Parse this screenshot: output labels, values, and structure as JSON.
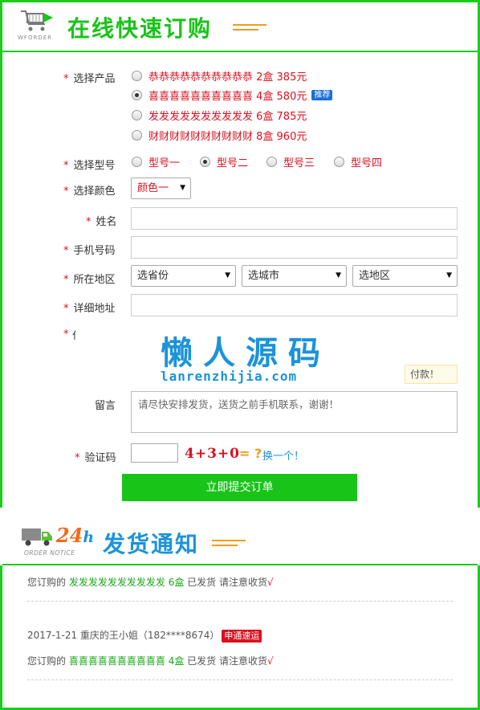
{
  "header": {
    "title": "在线快速订购",
    "logo_sub": "WFORDER"
  },
  "form": {
    "product_label": "选择产品",
    "products": [
      {
        "label": "恭恭恭恭恭恭恭恭恭恭 2盒 385元",
        "checked": false
      },
      {
        "label": "喜喜喜喜喜喜喜喜喜喜 4盒 580元",
        "checked": true,
        "badge": "推荐"
      },
      {
        "label": "发发发发发发发发发发 6盒 785元",
        "checked": false
      },
      {
        "label": "财财财财财财财财财财 8盒 960元",
        "checked": false
      }
    ],
    "model_label": "选择型号",
    "models": [
      {
        "label": "型号一",
        "checked": false
      },
      {
        "label": "型号二",
        "checked": true
      },
      {
        "label": "型号三",
        "checked": false
      },
      {
        "label": "型号四",
        "checked": false
      }
    ],
    "color_label": "选择颜色",
    "color_value": "颜色一",
    "name_label": "姓名",
    "phone_label": "手机号码",
    "region_label": "所在地区",
    "province_value": "选省份",
    "city_value": "选城市",
    "district_value": "选地区",
    "address_label": "详细地址",
    "pay_fragment": "付款！",
    "message_label": "留言",
    "message_value": "请尽快安排发货，送货之前手机联系，谢谢！",
    "captcha_label": "验证码",
    "captcha_expr": "4+3+0",
    "captcha_eq": "= ?",
    "captcha_refresh": "换一个！",
    "submit_label": "立即提交订单"
  },
  "watermark": {
    "cn": "懒人源码",
    "en": "lanrenzhijia.com"
  },
  "notice": {
    "title": "发货通知",
    "big": "24",
    "h": "h",
    "sub": "ORDER NOTICE",
    "entries": [
      {
        "prefix": "您订购的",
        "product": "发发发发发发发发发发",
        "qty": "6盒",
        "status": "已发货 请注意收货",
        "check": "√"
      },
      {
        "meta": "2017-1-21 重庆的王小姐（182****8674）",
        "express": "申通速运",
        "prefix": "您订购的",
        "product": "喜喜喜喜喜喜喜喜喜喜",
        "qty": "4盒",
        "status": "已发货 请注意收货",
        "check": "√"
      }
    ]
  },
  "colors": {
    "brand_green": "#19c419",
    "accent_red": "#d9111f",
    "accent_blue": "#1b93d8",
    "accent_orange": "#f29b1d"
  }
}
